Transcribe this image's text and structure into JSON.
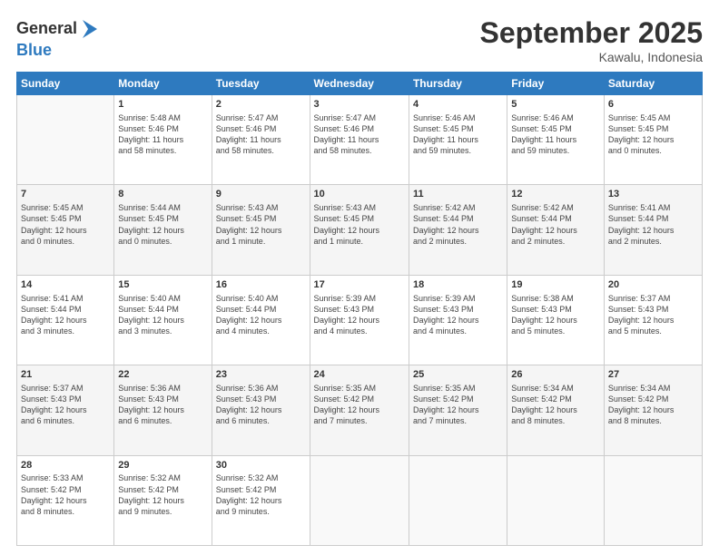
{
  "logo": {
    "general": "General",
    "blue": "Blue"
  },
  "title": "September 2025",
  "location": "Kawalu, Indonesia",
  "days_header": [
    "Sunday",
    "Monday",
    "Tuesday",
    "Wednesday",
    "Thursday",
    "Friday",
    "Saturday"
  ],
  "weeks": [
    [
      {
        "day": "",
        "info": ""
      },
      {
        "day": "1",
        "info": "Sunrise: 5:48 AM\nSunset: 5:46 PM\nDaylight: 11 hours\nand 58 minutes."
      },
      {
        "day": "2",
        "info": "Sunrise: 5:47 AM\nSunset: 5:46 PM\nDaylight: 11 hours\nand 58 minutes."
      },
      {
        "day": "3",
        "info": "Sunrise: 5:47 AM\nSunset: 5:46 PM\nDaylight: 11 hours\nand 58 minutes."
      },
      {
        "day": "4",
        "info": "Sunrise: 5:46 AM\nSunset: 5:45 PM\nDaylight: 11 hours\nand 59 minutes."
      },
      {
        "day": "5",
        "info": "Sunrise: 5:46 AM\nSunset: 5:45 PM\nDaylight: 11 hours\nand 59 minutes."
      },
      {
        "day": "6",
        "info": "Sunrise: 5:45 AM\nSunset: 5:45 PM\nDaylight: 12 hours\nand 0 minutes."
      }
    ],
    [
      {
        "day": "7",
        "info": "Sunrise: 5:45 AM\nSunset: 5:45 PM\nDaylight: 12 hours\nand 0 minutes."
      },
      {
        "day": "8",
        "info": "Sunrise: 5:44 AM\nSunset: 5:45 PM\nDaylight: 12 hours\nand 0 minutes."
      },
      {
        "day": "9",
        "info": "Sunrise: 5:43 AM\nSunset: 5:45 PM\nDaylight: 12 hours\nand 1 minute."
      },
      {
        "day": "10",
        "info": "Sunrise: 5:43 AM\nSunset: 5:45 PM\nDaylight: 12 hours\nand 1 minute."
      },
      {
        "day": "11",
        "info": "Sunrise: 5:42 AM\nSunset: 5:44 PM\nDaylight: 12 hours\nand 2 minutes."
      },
      {
        "day": "12",
        "info": "Sunrise: 5:42 AM\nSunset: 5:44 PM\nDaylight: 12 hours\nand 2 minutes."
      },
      {
        "day": "13",
        "info": "Sunrise: 5:41 AM\nSunset: 5:44 PM\nDaylight: 12 hours\nand 2 minutes."
      }
    ],
    [
      {
        "day": "14",
        "info": "Sunrise: 5:41 AM\nSunset: 5:44 PM\nDaylight: 12 hours\nand 3 minutes."
      },
      {
        "day": "15",
        "info": "Sunrise: 5:40 AM\nSunset: 5:44 PM\nDaylight: 12 hours\nand 3 minutes."
      },
      {
        "day": "16",
        "info": "Sunrise: 5:40 AM\nSunset: 5:44 PM\nDaylight: 12 hours\nand 4 minutes."
      },
      {
        "day": "17",
        "info": "Sunrise: 5:39 AM\nSunset: 5:43 PM\nDaylight: 12 hours\nand 4 minutes."
      },
      {
        "day": "18",
        "info": "Sunrise: 5:39 AM\nSunset: 5:43 PM\nDaylight: 12 hours\nand 4 minutes."
      },
      {
        "day": "19",
        "info": "Sunrise: 5:38 AM\nSunset: 5:43 PM\nDaylight: 12 hours\nand 5 minutes."
      },
      {
        "day": "20",
        "info": "Sunrise: 5:37 AM\nSunset: 5:43 PM\nDaylight: 12 hours\nand 5 minutes."
      }
    ],
    [
      {
        "day": "21",
        "info": "Sunrise: 5:37 AM\nSunset: 5:43 PM\nDaylight: 12 hours\nand 6 minutes."
      },
      {
        "day": "22",
        "info": "Sunrise: 5:36 AM\nSunset: 5:43 PM\nDaylight: 12 hours\nand 6 minutes."
      },
      {
        "day": "23",
        "info": "Sunrise: 5:36 AM\nSunset: 5:43 PM\nDaylight: 12 hours\nand 6 minutes."
      },
      {
        "day": "24",
        "info": "Sunrise: 5:35 AM\nSunset: 5:42 PM\nDaylight: 12 hours\nand 7 minutes."
      },
      {
        "day": "25",
        "info": "Sunrise: 5:35 AM\nSunset: 5:42 PM\nDaylight: 12 hours\nand 7 minutes."
      },
      {
        "day": "26",
        "info": "Sunrise: 5:34 AM\nSunset: 5:42 PM\nDaylight: 12 hours\nand 8 minutes."
      },
      {
        "day": "27",
        "info": "Sunrise: 5:34 AM\nSunset: 5:42 PM\nDaylight: 12 hours\nand 8 minutes."
      }
    ],
    [
      {
        "day": "28",
        "info": "Sunrise: 5:33 AM\nSunset: 5:42 PM\nDaylight: 12 hours\nand 8 minutes."
      },
      {
        "day": "29",
        "info": "Sunrise: 5:32 AM\nSunset: 5:42 PM\nDaylight: 12 hours\nand 9 minutes."
      },
      {
        "day": "30",
        "info": "Sunrise: 5:32 AM\nSunset: 5:42 PM\nDaylight: 12 hours\nand 9 minutes."
      },
      {
        "day": "",
        "info": ""
      },
      {
        "day": "",
        "info": ""
      },
      {
        "day": "",
        "info": ""
      },
      {
        "day": "",
        "info": ""
      }
    ]
  ]
}
